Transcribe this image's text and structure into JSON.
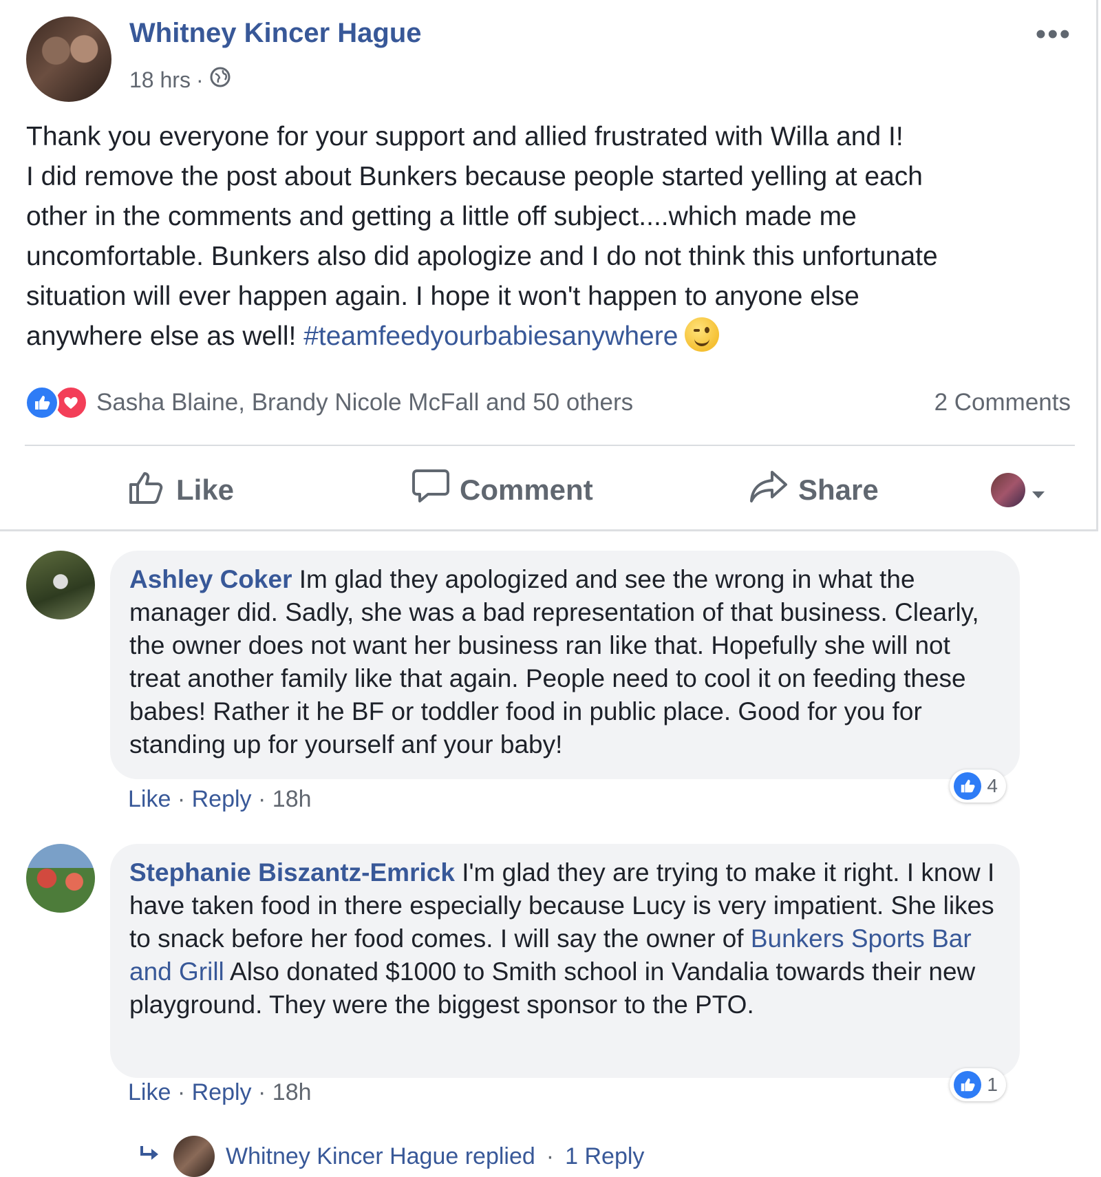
{
  "post": {
    "author": "Whitney Kincer Hague",
    "time": "18 hrs",
    "meta_separator": "·",
    "privacy_icon": "globe-icon",
    "more_icon": "more-dots-icon",
    "more_label": "•••",
    "body_lines": [
      "Thank you everyone for your support and allied frustrated with Willa and I!",
      "I did remove the post about Bunkers because people started yelling at each",
      "other in the comments and getting a little off subject....which made me",
      "uncomfortable. Bunkers also did apologize and I do not think this unfortunate",
      "situation will ever happen again. I hope it won't happen to anyone else"
    ],
    "body_last_line": "anywhere else as well! ",
    "hashtag": "#teamfeedyourbabiesanywhere",
    "emoji": "wink-emoji",
    "reactions_text": "Sasha Blaine, Brandy Nicole McFall and 50 others",
    "comments_count": "2 Comments",
    "actions": {
      "like": "Like",
      "comment": "Comment",
      "share": "Share"
    }
  },
  "comments": [
    {
      "name": "Ashley Coker",
      "text": "Im glad they apologized and see the wrong in what the manager did. Sadly, she was a bad representation of that business. Clearly, the owner does not want her business ran like that. Hopefully she will not treat another family like that again. People need to cool it on feeding these babes! Rather it he BF or toddler food in public place. Good for you for standing up for yourself anf your baby!",
      "likes": "4",
      "like_label": "Like",
      "reply_label": "Reply",
      "separator": "·",
      "time": "18h"
    },
    {
      "name": "Stephanie Biszantz-Emrick",
      "text_before": "I'm glad they are trying to make it right. I know I have taken food in there especially because Lucy is very impatient. She likes to snack before her food comes. I will say the owner of ",
      "link": "Bunkers Sports Bar and Grill",
      "text_after": " Also donated $1000 to Smith school in Vandalia towards their new playground. They were the biggest sponsor to the PTO.",
      "likes": "1",
      "like_label": "Like",
      "reply_label": "Reply",
      "separator": "·",
      "time": "18h"
    }
  ],
  "reply_summary": {
    "text": "Whitney Kincer Hague replied",
    "separator": "·",
    "count": "1 Reply"
  },
  "colors": {
    "link": "#385898",
    "like_blue": "#2e7cf6",
    "love_red": "#f33e58",
    "muted": "#616770",
    "bubble": "#f2f3f5"
  }
}
